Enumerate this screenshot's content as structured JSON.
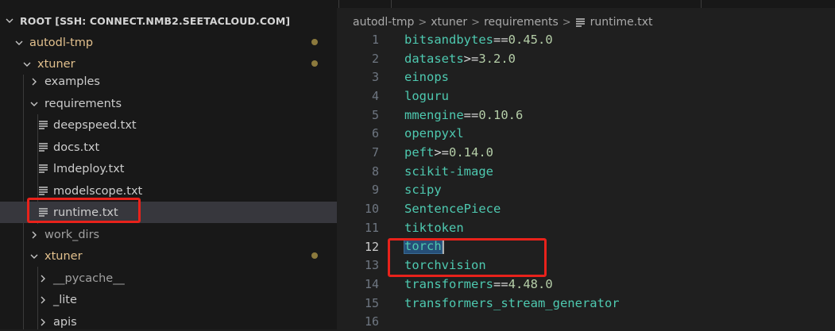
{
  "explorer": {
    "root_title": "ROOT [SSH: CONNECT.NMB2.SEETACLOUD.COM]",
    "items": [
      {
        "label": "autodl-tmp",
        "type": "folder",
        "expanded": true,
        "modified": true
      },
      {
        "label": "xtuner",
        "type": "folder",
        "expanded": true,
        "modified": true
      },
      {
        "label": "examples",
        "type": "folder",
        "expanded": false,
        "modified": false
      },
      {
        "label": "requirements",
        "type": "folder",
        "expanded": true,
        "modified": false
      },
      {
        "label": "deepspeed.txt",
        "type": "file"
      },
      {
        "label": "docs.txt",
        "type": "file"
      },
      {
        "label": "lmdeploy.txt",
        "type": "file"
      },
      {
        "label": "modelscope.txt",
        "type": "file"
      },
      {
        "label": "runtime.txt",
        "type": "file",
        "selected": true
      },
      {
        "label": "work_dirs",
        "type": "folder",
        "expanded": false
      },
      {
        "label": "xtuner",
        "type": "folder",
        "expanded": true,
        "modified": true
      },
      {
        "label": "__pycache__",
        "type": "folder",
        "expanded": false
      },
      {
        "label": "_lite",
        "type": "folder",
        "expanded": false
      },
      {
        "label": "apis",
        "type": "folder",
        "expanded": false
      }
    ]
  },
  "breadcrumb": [
    "autodl-tmp",
    "xtuner",
    "requirements",
    "runtime.txt"
  ],
  "editor": {
    "active_line": 12,
    "lines": [
      {
        "n": "1",
        "pkg": "bitsandbytes",
        "op": "==",
        "ver": "0.45.0"
      },
      {
        "n": "2",
        "pkg": "datasets",
        "op": ">=",
        "ver": "3.2.0"
      },
      {
        "n": "3",
        "pkg": "einops",
        "op": "",
        "ver": ""
      },
      {
        "n": "4",
        "pkg": "loguru",
        "op": "",
        "ver": ""
      },
      {
        "n": "5",
        "pkg": "mmengine",
        "op": "==",
        "ver": "0.10.6"
      },
      {
        "n": "6",
        "pkg": "openpyxl",
        "op": "",
        "ver": ""
      },
      {
        "n": "7",
        "pkg": "peft",
        "op": ">=",
        "ver": "0.14.0"
      },
      {
        "n": "8",
        "pkg": "scikit-image",
        "op": "",
        "ver": ""
      },
      {
        "n": "9",
        "pkg": "scipy",
        "op": "",
        "ver": ""
      },
      {
        "n": "10",
        "pkg": "SentencePiece",
        "op": "",
        "ver": ""
      },
      {
        "n": "11",
        "pkg": "tiktoken",
        "op": "",
        "ver": ""
      },
      {
        "n": "12",
        "pkg": "torch",
        "op": "",
        "ver": ""
      },
      {
        "n": "13",
        "pkg": "torchvision",
        "op": "",
        "ver": ""
      },
      {
        "n": "14",
        "pkg": "transformers",
        "op": "==",
        "ver": "4.48.0"
      },
      {
        "n": "15",
        "pkg": "transformers_stream_generator",
        "op": "",
        "ver": ""
      },
      {
        "n": "16",
        "pkg": "",
        "op": "",
        "ver": ""
      }
    ]
  },
  "colors": {
    "annotation_red": "#e8221b",
    "package_teal": "#4ec9b0",
    "version_green": "#b5cea8",
    "modified_yellow": "#e2c08d",
    "selection_blue": "#264f78"
  }
}
